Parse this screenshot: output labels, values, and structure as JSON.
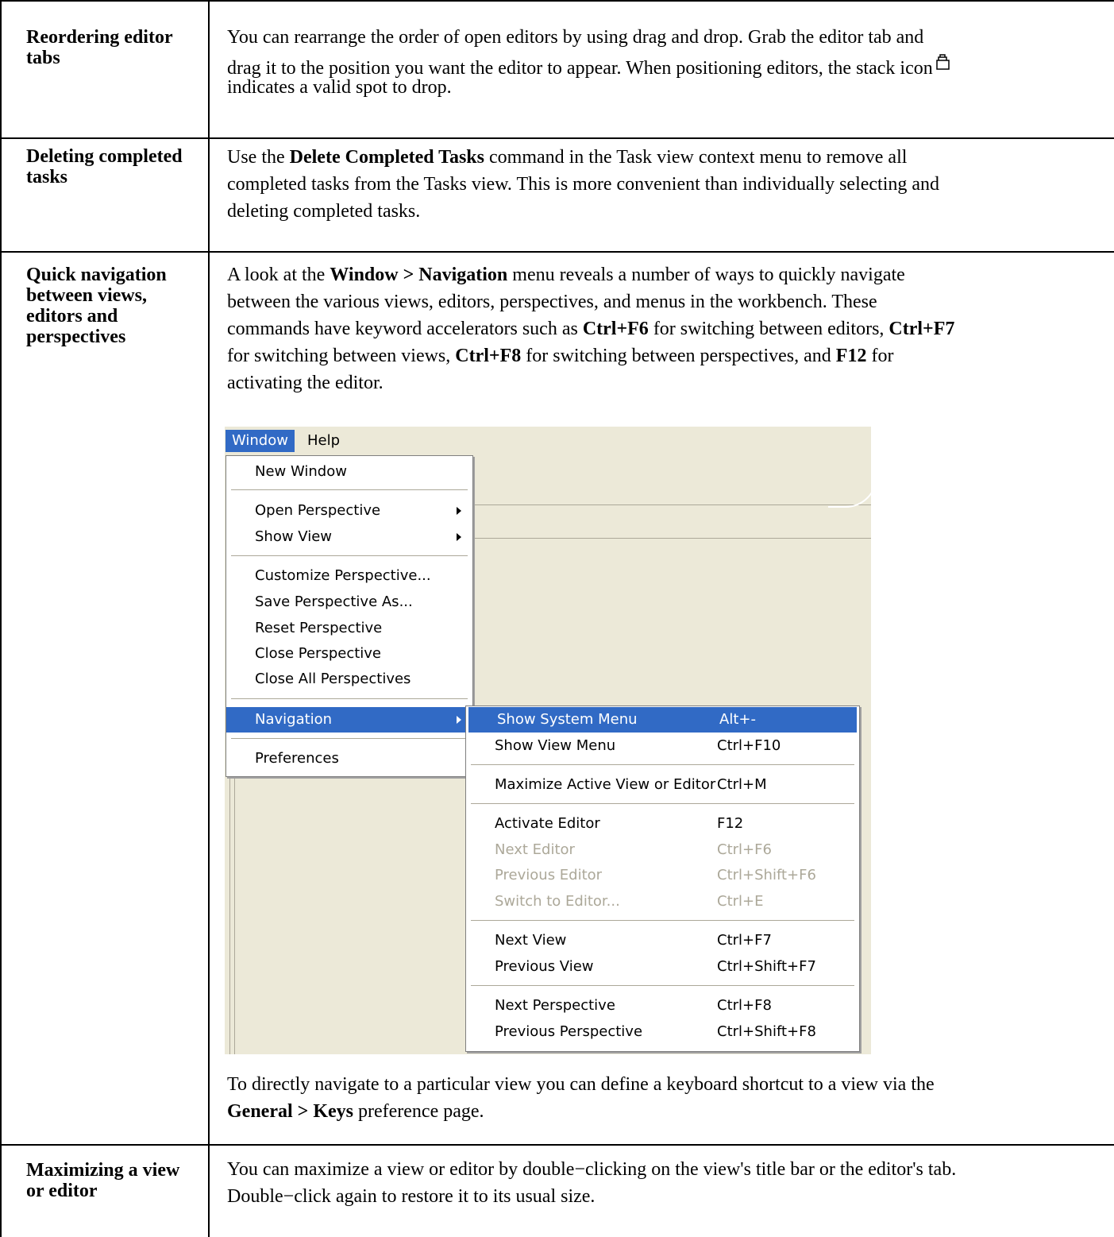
{
  "rows": [
    {
      "term": "Reordering editor tabs",
      "lines": [
        "You can rearrange the order of open editors by using drag and drop. Grab the editor tab and",
        "drag it to the position you want the editor to appear. When positioning editors, the stack icon",
        "indicates a valid spot to drop."
      ],
      "icon": "stack-icon"
    },
    {
      "term": "Deleting completed tasks",
      "line1_pre": "Use the ",
      "line1_bold": "Delete Completed Tasks",
      "line1_post": " command in the Task view context menu to remove all",
      "line2": "completed tasks from the Tasks view. This is more convenient than individually selecting and",
      "line3": "deleting completed tasks."
    },
    {
      "term": "Quick navigation between views, editors and perspectives",
      "l1_pre": "A look at the ",
      "l1_bold": "Window > Navigation",
      "l1_post": " menu reveals a number of ways to quickly navigate",
      "l2": "between the various views, editors, perspectives, and menus in the workbench. These",
      "l3_pre": "commands have keyword accelerators such as ",
      "l3_b1": "Ctrl+F6",
      "l3_mid": " for switching between editors, ",
      "l3_b2": "Ctrl+F7",
      "l4_pre": "for switching between views, ",
      "l4_b1": "Ctrl+F8",
      "l4_mid": " for switching between perspectives, and ",
      "l4_b2": "F12",
      "l4_post": " for",
      "l5": "activating the editor.",
      "after1": "To directly navigate to a particular view you can define a keyboard shortcut to a view via the",
      "after2_bold": "General > Keys",
      "after2_post": " preference page."
    },
    {
      "term": "Maximizing a view or editor",
      "line1": "You can maximize a view or editor by double−clicking on the view's title bar or the editor's tab.",
      "line2": "Double−click again to restore it to its usual size."
    }
  ],
  "screenshot": {
    "menubar": [
      "Window",
      "Help"
    ],
    "window_menu": [
      {
        "label": "New Window"
      },
      {
        "label": "Open Perspective",
        "submenu": true
      },
      {
        "label": "Show View",
        "submenu": true
      },
      {
        "label": "Customize Perspective..."
      },
      {
        "label": "Save Perspective As..."
      },
      {
        "label": "Reset Perspective"
      },
      {
        "label": "Close Perspective"
      },
      {
        "label": "Close All Perspectives"
      },
      {
        "label": "Navigation",
        "submenu": true,
        "highlighted": true
      },
      {
        "label": "Preferences"
      }
    ],
    "navigation_menu": [
      {
        "label": "Show System Menu",
        "shortcut": "Alt+-",
        "highlighted": true
      },
      {
        "label": "Show View Menu",
        "shortcut": "Ctrl+F10"
      },
      {
        "label": "Maximize Active View or Editor",
        "shortcut": "Ctrl+M"
      },
      {
        "label": "Activate Editor",
        "shortcut": "F12"
      },
      {
        "label": "Next Editor",
        "shortcut": "Ctrl+F6",
        "disabled": true
      },
      {
        "label": "Previous Editor",
        "shortcut": "Ctrl+Shift+F6",
        "disabled": true
      },
      {
        "label": "Switch to Editor...",
        "shortcut": "Ctrl+E",
        "disabled": true
      },
      {
        "label": "Next View",
        "shortcut": "Ctrl+F7"
      },
      {
        "label": "Previous View",
        "shortcut": "Ctrl+Shift+F7"
      },
      {
        "label": "Next Perspective",
        "shortcut": "Ctrl+F8"
      },
      {
        "label": "Previous Perspective",
        "shortcut": "Ctrl+Shift+F8"
      }
    ],
    "colors": {
      "highlight": "#316ac5",
      "disabled": "#aca899",
      "background": "#ece9d8"
    }
  }
}
